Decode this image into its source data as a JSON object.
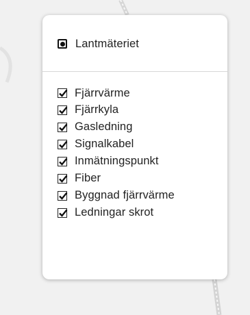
{
  "base_layers": [
    {
      "label": "Lantmäteriet",
      "selected": true
    }
  ],
  "overlays": [
    {
      "label": "Fjärrvärme",
      "checked": true
    },
    {
      "label": "Fjärrkyla",
      "checked": true
    },
    {
      "label": "Gasledning",
      "checked": true
    },
    {
      "label": "Signalkabel",
      "checked": true
    },
    {
      "label": "Inmätningspunkt",
      "checked": true
    },
    {
      "label": "Fiber",
      "checked": true
    },
    {
      "label": "Byggnad fjärrvärme",
      "checked": true
    },
    {
      "label": "Ledningar skrot",
      "checked": true
    }
  ],
  "colors": {
    "map_background": "#f1f1f1",
    "panel_background": "#ffffff",
    "text": "#222222"
  }
}
